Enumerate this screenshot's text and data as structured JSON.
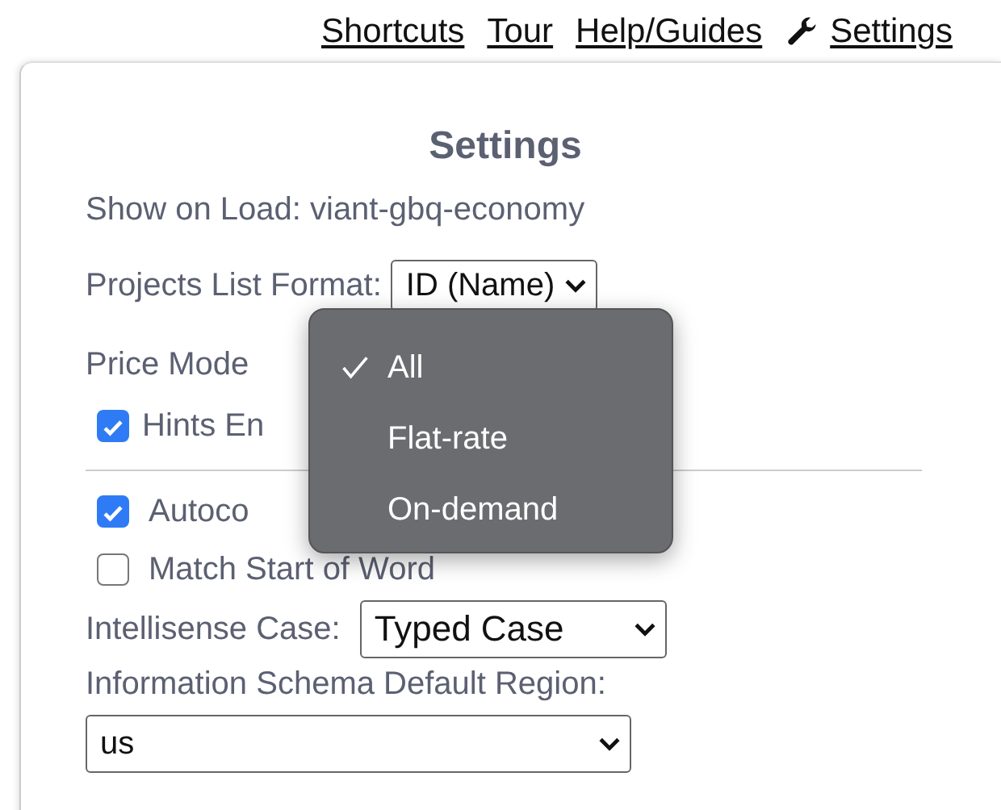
{
  "top_links": [
    "Shortcuts",
    "Tour",
    "Help/Guides"
  ],
  "settings_link": "Settings",
  "panel": {
    "title": "Settings",
    "show_on_load": "Show on Load: viant-gbq-economy",
    "projects_list_format": {
      "label": "Projects List Format:",
      "value": "ID (Name)"
    },
    "price_mode": {
      "label": "Price Mode"
    },
    "hints": {
      "label": "Hints En",
      "checked": true
    },
    "autocomplete": {
      "label": "Autoco",
      "checked": true
    },
    "match_start": {
      "label": "Match Start of Word",
      "checked": false
    },
    "intellisense_case": {
      "label": "Intellisense Case:",
      "value": "Typed Case"
    },
    "schema_region": {
      "label": "Information Schema Default Region:",
      "value": "us"
    }
  },
  "price_menu": {
    "items": [
      {
        "label": "All",
        "selected": true
      },
      {
        "label": "Flat-rate",
        "selected": false
      },
      {
        "label": "On-demand",
        "selected": false
      }
    ]
  }
}
